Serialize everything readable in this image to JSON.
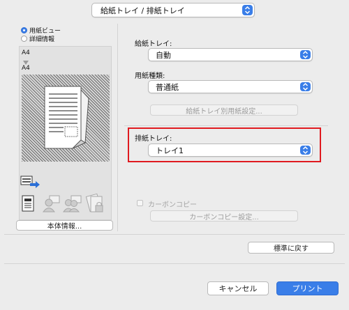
{
  "top": {
    "selector_value": "給紙トレイ / 排紙トレイ"
  },
  "preview": {
    "radio_paper_view": "用紙ビュー",
    "radio_detail_info": "詳細情報",
    "paper_top": "A4",
    "paper_bottom": "A4",
    "device_info_button": "本体情報..."
  },
  "settings": {
    "paper_tray_label": "給紙トレイ:",
    "paper_tray_value": "自動",
    "paper_type_label": "用紙種類:",
    "paper_type_value": "普通紙",
    "per_tray_button": "給紙トレイ別用紙設定...",
    "output_tray_label": "排紙トレイ:",
    "output_tray_value": "トレイ1",
    "carbon_copy_label": "カーボンコピー",
    "carbon_copy_settings_button": "カーボンコピー設定..."
  },
  "actions": {
    "restore_defaults": "標準に戻す",
    "cancel": "キャンセル",
    "print": "プリント"
  },
  "colors": {
    "accent": "#3a7ee8",
    "highlight": "#e0191f"
  }
}
